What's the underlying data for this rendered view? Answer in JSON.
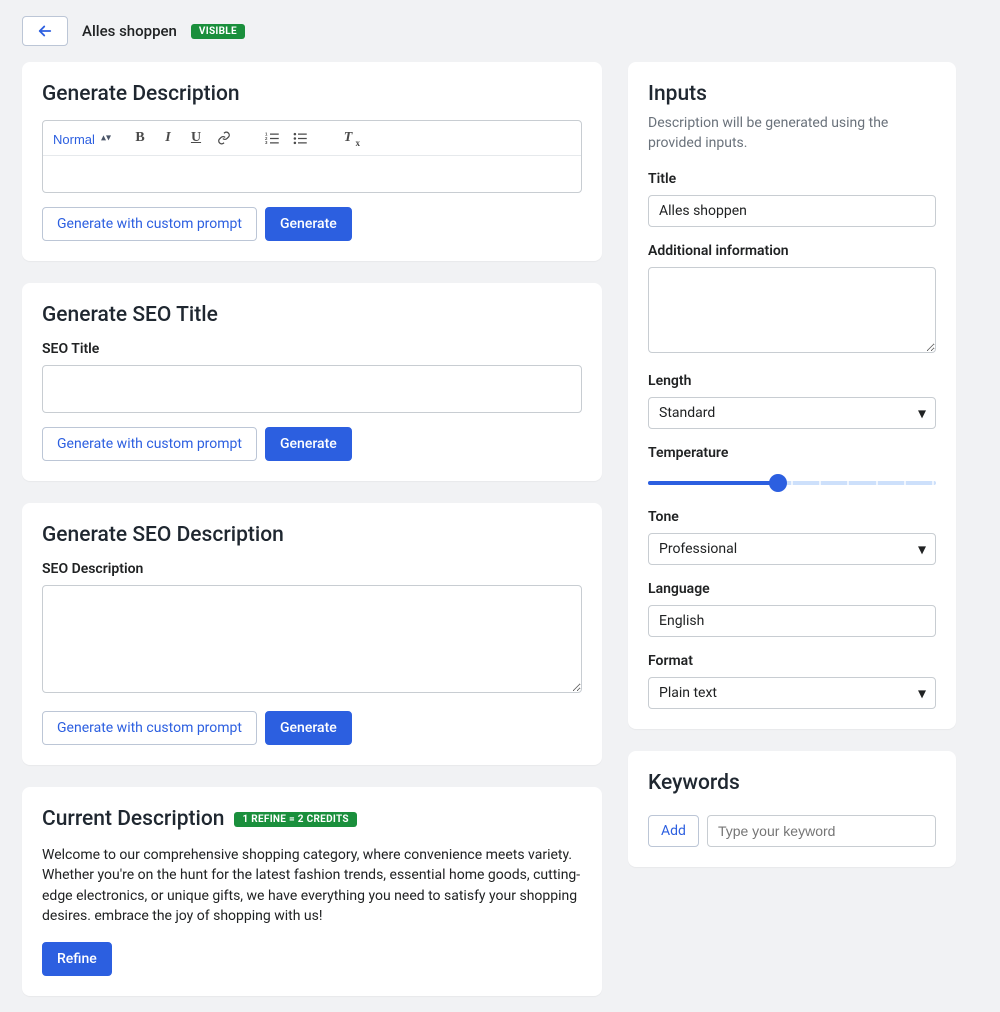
{
  "header": {
    "title": "Alles shoppen",
    "visibility": "VISIBLE"
  },
  "cards": {
    "generate_description": {
      "heading": "Generate Description",
      "toolbar_normal": "Normal",
      "custom_btn": "Generate with custom prompt",
      "generate_btn": "Generate"
    },
    "generate_seo_title": {
      "heading": "Generate SEO Title",
      "label": "SEO Title",
      "value": "",
      "custom_btn": "Generate with custom prompt",
      "generate_btn": "Generate"
    },
    "generate_seo_description": {
      "heading": "Generate SEO Description",
      "label": "SEO Description",
      "value": "",
      "custom_btn": "Generate with custom prompt",
      "generate_btn": "Generate"
    },
    "current_description": {
      "heading": "Current Description",
      "badge": "1 REFINE = 2 CREDITS",
      "body": "Welcome to our comprehensive shopping category, where convenience meets variety. Whether you're on the hunt for the latest fashion trends, essential home goods, cutting-edge electronics, or unique gifts, we have everything you need to satisfy your shopping desires. embrace the joy of shopping with us!",
      "refine_btn": "Refine"
    }
  },
  "inputs_panel": {
    "heading": "Inputs",
    "subtitle": "Description will be generated using the provided inputs.",
    "title_label": "Title",
    "title_value": "Alles shoppen",
    "additional_label": "Additional information",
    "additional_value": "",
    "length_label": "Length",
    "length_value": "Standard",
    "temperature_label": "Temperature",
    "tone_label": "Tone",
    "tone_value": "Professional",
    "language_label": "Language",
    "language_value": "English",
    "format_label": "Format",
    "format_value": "Plain text"
  },
  "keywords_panel": {
    "heading": "Keywords",
    "add_btn": "Add",
    "placeholder": "Type your keyword"
  }
}
